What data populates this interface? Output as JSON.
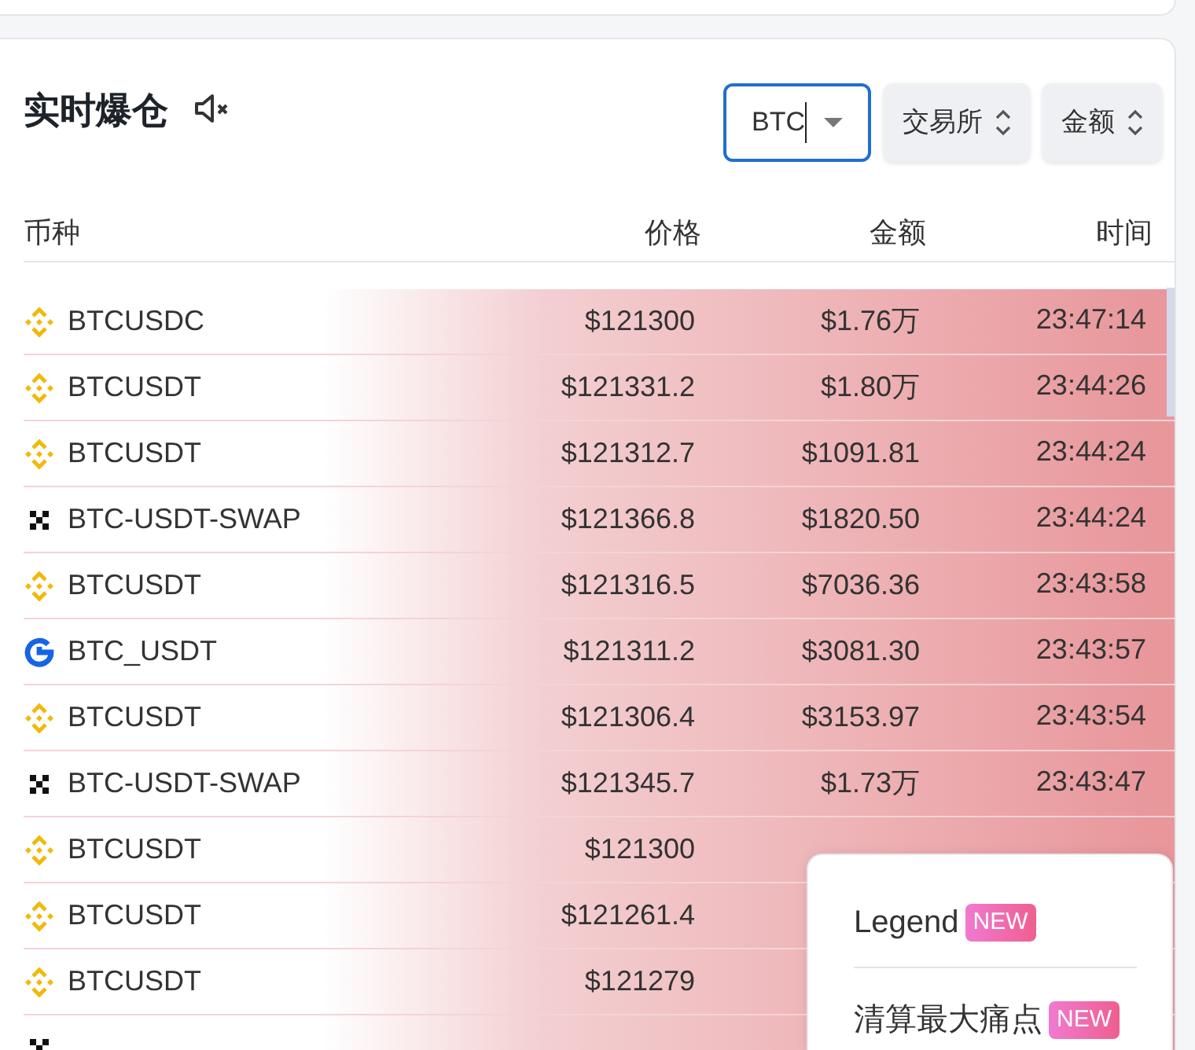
{
  "title": "实时爆仓",
  "filters": [
    {
      "kind": "input",
      "value": "BTC"
    },
    {
      "kind": "select",
      "label": "交易所"
    },
    {
      "kind": "select",
      "label": "金额"
    }
  ],
  "table": {
    "columns": [
      "币种",
      "价格",
      "金额",
      "时间"
    ],
    "rows": [
      {
        "kind": "binance",
        "symbol": "BTCUSDC",
        "price": "$121300",
        "amount": "$1.76万",
        "time": "23:47:14"
      },
      {
        "kind": "binance",
        "symbol": "BTCUSDT",
        "price": "$121331.2",
        "amount": "$1.80万",
        "time": "23:44:26"
      },
      {
        "kind": "binance",
        "symbol": "BTCUSDT",
        "price": "$121312.7",
        "amount": "$1091.81",
        "time": "23:44:24"
      },
      {
        "kind": "okx",
        "symbol": "BTC-USDT-SWAP",
        "price": "$121366.8",
        "amount": "$1820.50",
        "time": "23:44:24"
      },
      {
        "kind": "binance",
        "symbol": "BTCUSDT",
        "price": "$121316.5",
        "amount": "$7036.36",
        "time": "23:43:58"
      },
      {
        "kind": "gate",
        "symbol": "BTC_USDT",
        "price": "$121311.2",
        "amount": "$3081.30",
        "time": "23:43:57"
      },
      {
        "kind": "binance",
        "symbol": "BTCUSDT",
        "price": "$121306.4",
        "amount": "$3153.97",
        "time": "23:43:54"
      },
      {
        "kind": "okx",
        "symbol": "BTC-USDT-SWAP",
        "price": "$121345.7",
        "amount": "$1.73万",
        "time": "23:43:47"
      },
      {
        "kind": "binance",
        "symbol": "BTCUSDT",
        "price": "$121300"
      },
      {
        "kind": "binance",
        "symbol": "BTCUSDT",
        "price": "$121261.4"
      },
      {
        "kind": "binance",
        "symbol": "BTCUSDT",
        "price": "$121279"
      },
      {
        "kind": "okx"
      }
    ]
  },
  "popup": {
    "items": [
      {
        "label": "Legend",
        "badge": "NEW"
      },
      {
        "label": "清算最大痛点",
        "badge": "NEW"
      }
    ]
  }
}
